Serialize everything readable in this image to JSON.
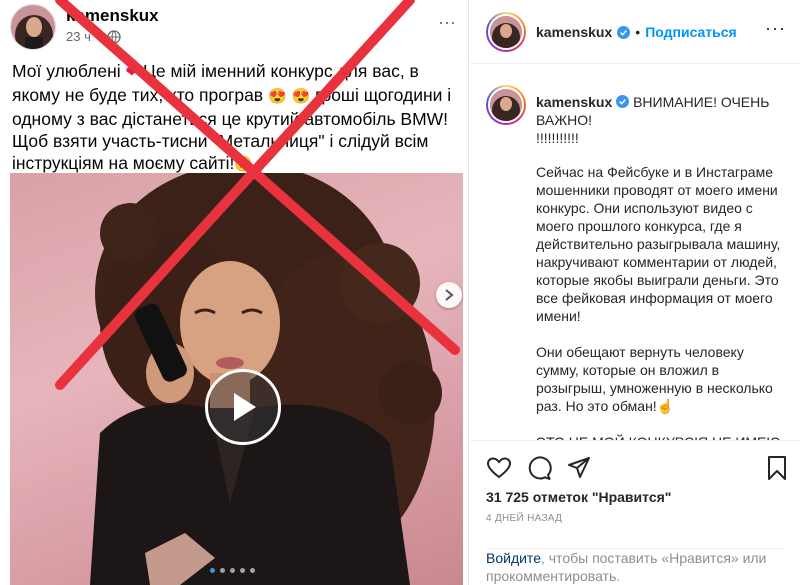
{
  "facebook_post": {
    "author": "kamenskux",
    "timestamp": "23 ч",
    "text_lines": [
      "Мої улюблені ",
      "Це мій іменний конкурс для вас, в",
      "якому не буде тих, хто програв ",
      " гроші щогодини і",
      "одному з вас дістанеться це крутий автомобіль BMW!",
      "Щоб взяти участь-тисни \"Метальниця\" і слідуй всім",
      "інструкціям на моєму сайті!"
    ],
    "icons": [
      "red-heart-icon",
      "heart-eyes-emoji-icon",
      "globe-icon",
      "play-icon",
      "chevron-right-icon",
      "red-cross-overlay"
    ],
    "carousel_pages": 5,
    "carousel_active": 1
  },
  "instagram": {
    "header": {
      "username": "kamenskux",
      "separator": "•",
      "follow_label": "Подписаться"
    },
    "caption": {
      "username": "kamenskux",
      "headline": "ВНИМАНИЕ! ОЧЕНЬ ВАЖНО!",
      "exclaim": "!!!!!!!!!!!",
      "body": "Сейчас на Фейсбуке и в Инстаграме мошенники проводят от моего имени конкурс. Они используют видео с моего прошлого конкурса, где я действительно разыгрывала машину, накручивают комментарии от людей, которые якобы выиграли деньги. Это все фейковая информация от моего имени!\n\nОни обещают вернуть человеку сумму, которые он вложил в розыгрыш, умноженную в несколько раз. Но это обман!☝\n\nЭТО НЕ МОЙ КОНКУРС!Я НЕ ИМЕЮ"
    },
    "likes": "31 725 отметок \"Нравится\"",
    "posted": "4 ДНЕЙ НАЗАД",
    "login_link": "Войдите",
    "login_text": ", чтобы поставить «Нравится» или прокомментировать.",
    "colors": {
      "link": "#0095f6",
      "cross": "#e8333f",
      "verified": "#3897f0"
    }
  }
}
